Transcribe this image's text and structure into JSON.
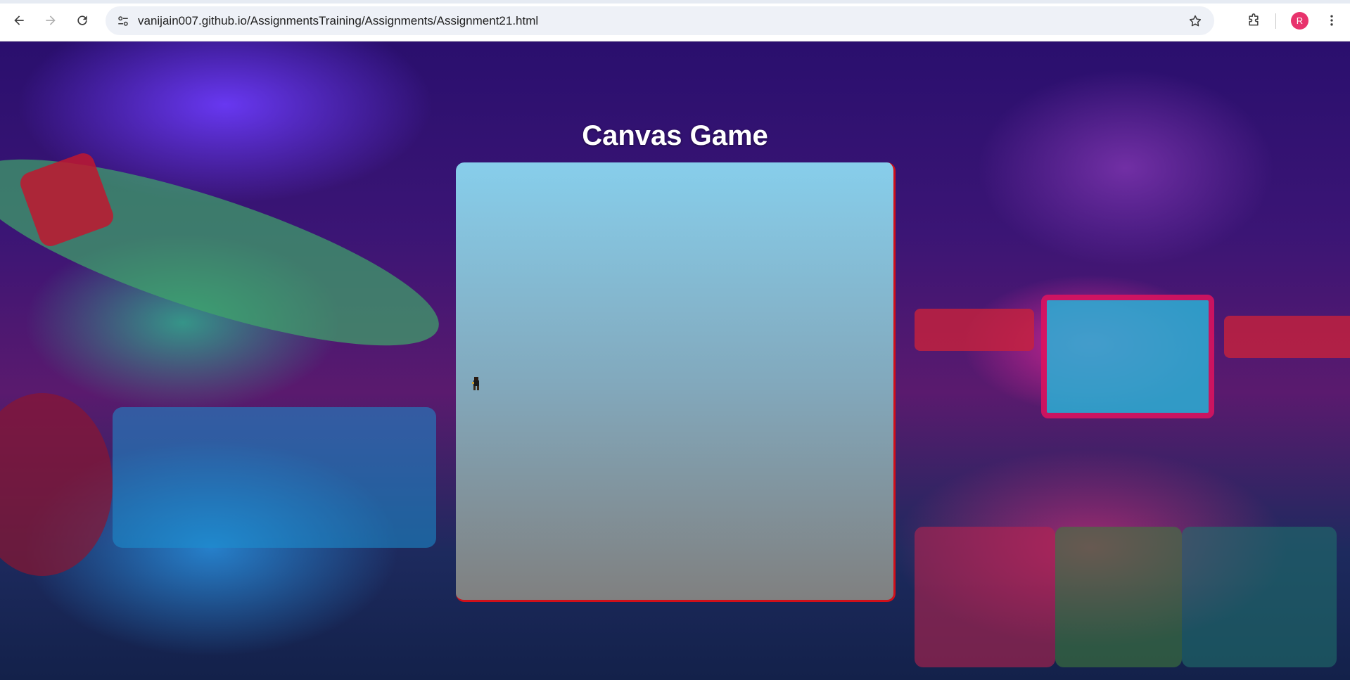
{
  "browser": {
    "url": "vanijain007.github.io/AssignmentsTraining/Assignments/Assignment21.html",
    "profile_initial": "R",
    "profile_color": "#e8336d"
  },
  "page": {
    "title": "Canvas Game",
    "canvas_gradient": [
      "#87ceeb",
      "#808080"
    ],
    "canvas_border_color": "#d0101a"
  },
  "icons": {
    "back": "arrow-left-icon",
    "forward": "arrow-right-icon",
    "reload": "reload-icon",
    "site_info": "tune-icon",
    "bookmark": "star-icon",
    "extensions": "puzzle-icon",
    "menu": "kebab-menu-icon"
  }
}
